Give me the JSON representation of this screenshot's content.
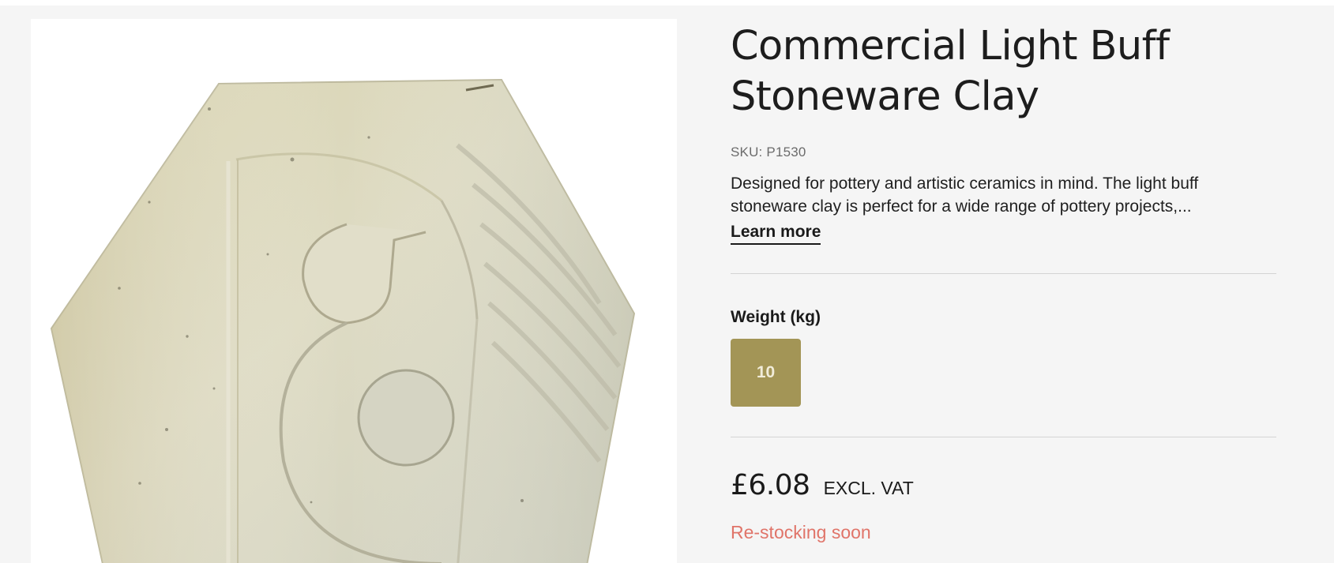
{
  "product": {
    "title_line1": "Commercial Light Buff",
    "title_line2": "Stoneware Clay",
    "sku": "SKU: P1530",
    "description": "Designed for pottery and artistic ceramics in mind. The light buff stoneware clay is perfect for a wide range of pottery projects,...",
    "learn_more": "Learn more"
  },
  "options": {
    "label": "Weight (kg)",
    "values": [
      "10"
    ]
  },
  "pricing": {
    "price": "£6.08",
    "vat_note": "EXCL. VAT"
  },
  "availability": {
    "status": "Re-stocking soon",
    "status_color": "#e07469"
  },
  "colors": {
    "accent": "#a39556",
    "background": "#f5f5f5",
    "tile_glaze": "#d9d6bd"
  },
  "image": {
    "icon": "hexagonal-clay-tile-image"
  }
}
